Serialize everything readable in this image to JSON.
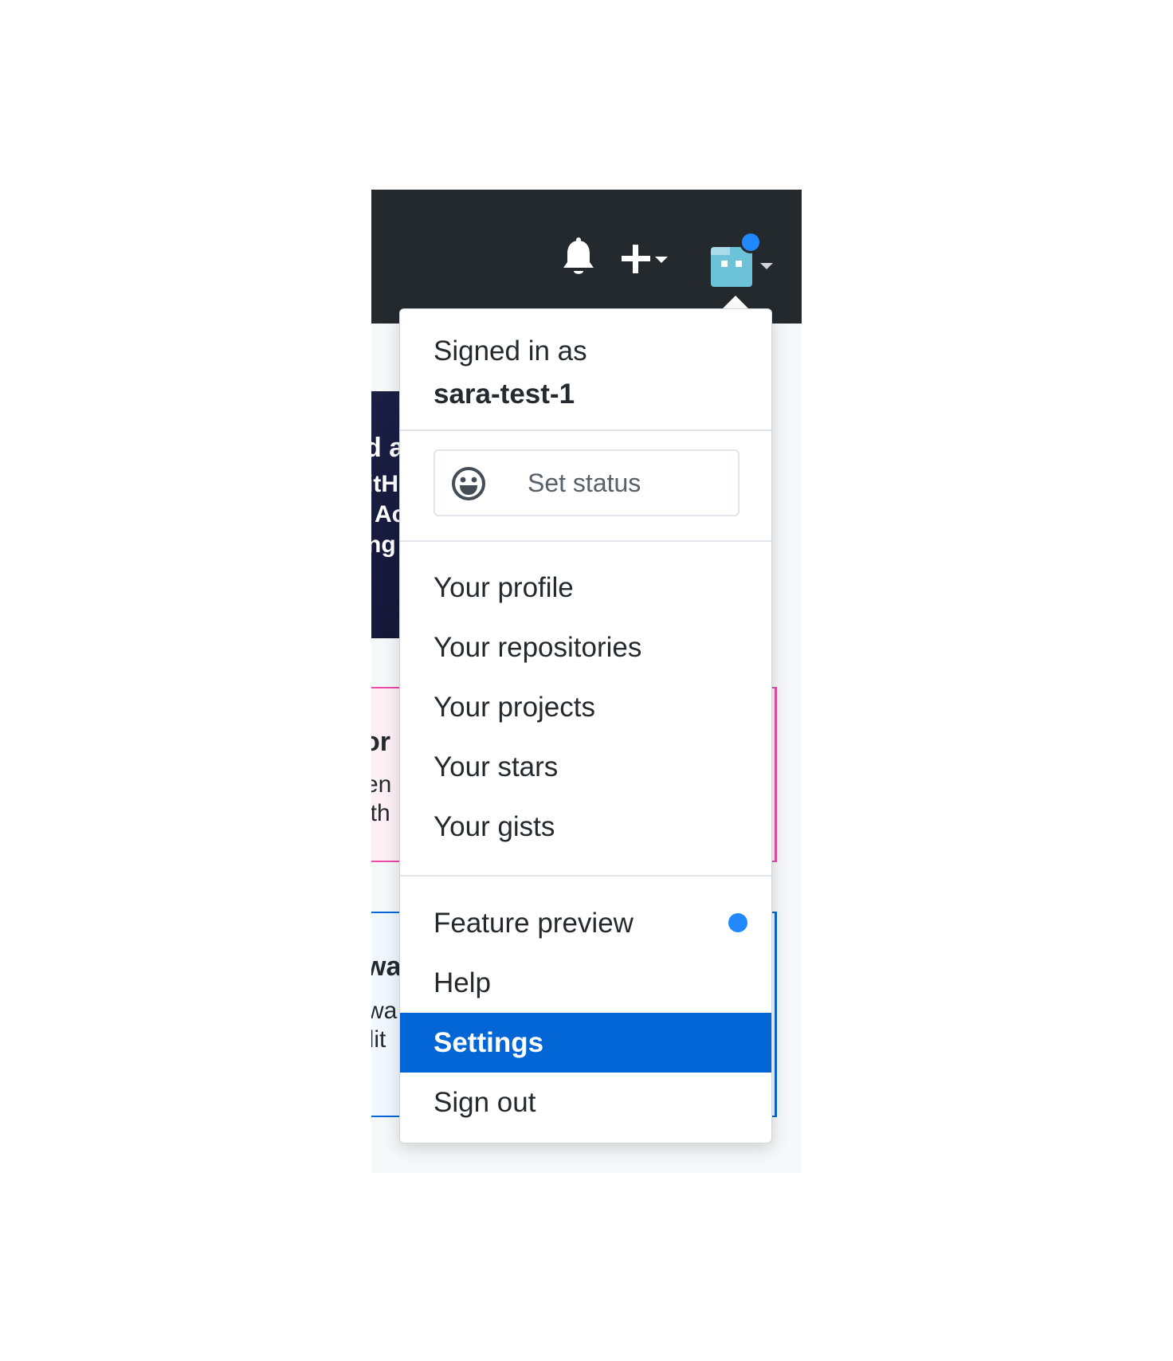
{
  "header": {
    "notifications_icon": "bell-icon",
    "create_icon": "plus-icon",
    "avatar_icon": "avatar-identicon",
    "notification_color": "#2188ff"
  },
  "background_fragments": {
    "banner": [
      "d a",
      "itH",
      "Ac",
      "ng"
    ],
    "pink_card": [
      "or",
      "en",
      "ith"
    ],
    "blue_card": [
      "wa",
      "wa",
      "ilit"
    ]
  },
  "dropdown": {
    "signed_in_label": "Signed in as",
    "username": "sara-test-1",
    "status_button": {
      "label": "Set status",
      "icon": "smiley-icon"
    },
    "section_one": [
      {
        "label": "Your profile"
      },
      {
        "label": "Your repositories"
      },
      {
        "label": "Your projects"
      },
      {
        "label": "Your stars"
      },
      {
        "label": "Your gists"
      }
    ],
    "section_two": [
      {
        "label": "Feature preview",
        "indicator": "blue-dot"
      },
      {
        "label": "Help"
      },
      {
        "label": "Settings",
        "active": true
      },
      {
        "label": "Sign out"
      }
    ],
    "colors": {
      "active_bg": "#0366d6",
      "accent_dot": "#2188ff"
    }
  }
}
